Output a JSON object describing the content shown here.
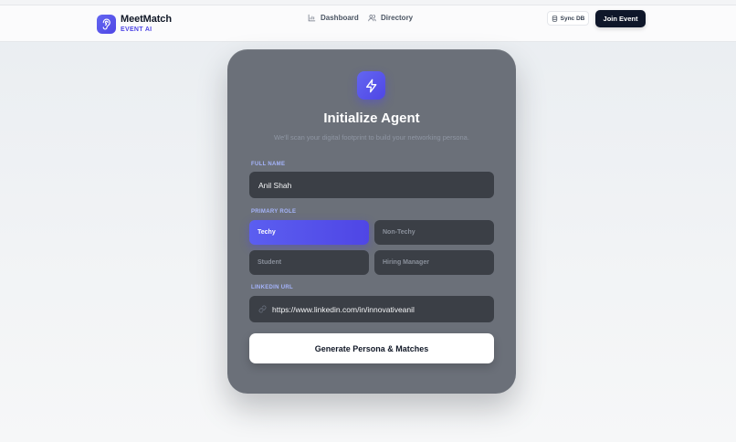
{
  "brand": {
    "name": "MeetMatch",
    "subtitle": "EVENT AI",
    "logo_icon": "ear-icon",
    "accent": "#4f46e5"
  },
  "nav": {
    "links": [
      {
        "label": "Dashboard",
        "icon": "bar-chart-icon"
      },
      {
        "label": "Directory",
        "icon": "users-icon"
      }
    ],
    "sync_label": "Sync DB",
    "sync_icon": "database-icon",
    "join_label": "Join Event"
  },
  "card": {
    "icon": "lightning-icon",
    "title": "Initialize Agent",
    "subtitle": "We'll scan your digital footprint to build your networking persona.",
    "full_name": {
      "label": "FULL NAME",
      "value": "Anil Shah"
    },
    "primary_role": {
      "label": "PRIMARY ROLE",
      "options": [
        "Techy",
        "Non-Techy",
        "Student",
        "Hiring Manager"
      ],
      "selected": "Techy"
    },
    "linkedin": {
      "label": "LINKEDIN URL",
      "value": "https://www.linkedin.com/in/innovativeanil",
      "icon": "link-icon"
    },
    "submit_label": "Generate Persona & Matches",
    "colors": {
      "card_bg": "#6b7079",
      "field_bg": "#3b3f46",
      "label": "#a5b4fc",
      "selected": "#4f46e5"
    }
  }
}
